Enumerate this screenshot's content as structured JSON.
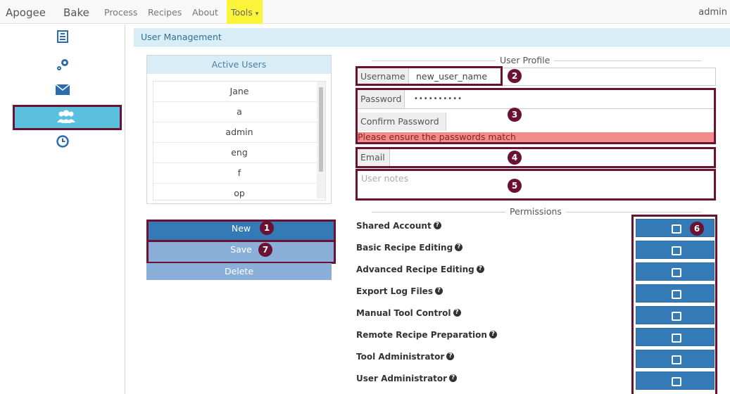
{
  "nav": {
    "brand_apogee": "Apogee",
    "brand_bake": "Bake",
    "items": [
      "Process",
      "Recipes",
      "About"
    ],
    "tools": "Tools",
    "tools_caret": "▾",
    "user": "admin"
  },
  "sidebar": {
    "icons": [
      "document-icon",
      "gears-icon",
      "envelope-icon",
      "users-icon",
      "clock-icon"
    ],
    "active": "users-icon"
  },
  "panel": {
    "title": "User Management"
  },
  "users": {
    "title": "Active Users",
    "list": [
      "Jane",
      "a",
      "admin",
      "eng",
      "f",
      "op"
    ]
  },
  "buttons": {
    "new": "New",
    "save": "Save",
    "delete": "Delete"
  },
  "profile": {
    "legend": "User Profile",
    "username_label": "Username",
    "username_value": "new_user_name",
    "password_label": "Password",
    "password_value": "••••••••••",
    "confirm_label": "Confirm Password",
    "confirm_value": "",
    "error": "Please ensure the passwords match",
    "email_label": "Email",
    "email_value": "",
    "notes_placeholder": "User notes"
  },
  "permissions": {
    "legend": "Permissions",
    "items": [
      "Shared Account",
      "Basic Recipe Editing",
      "Advanced Recipe Editing",
      "Export Log Files",
      "Manual Tool Control",
      "Remote Recipe Preparation",
      "Tool Administrator",
      "User Administrator"
    ],
    "help_glyph": "?"
  },
  "badges": [
    "1",
    "2",
    "3",
    "4",
    "5",
    "6",
    "7"
  ],
  "colors": {
    "accent": "#337ab7",
    "highlight": "#6b1232",
    "error_bg": "#f28c8c",
    "info_bg": "#d9edf7",
    "nav_tools_bg": "#fcf33b",
    "sidebar_active": "#5bc0de"
  }
}
